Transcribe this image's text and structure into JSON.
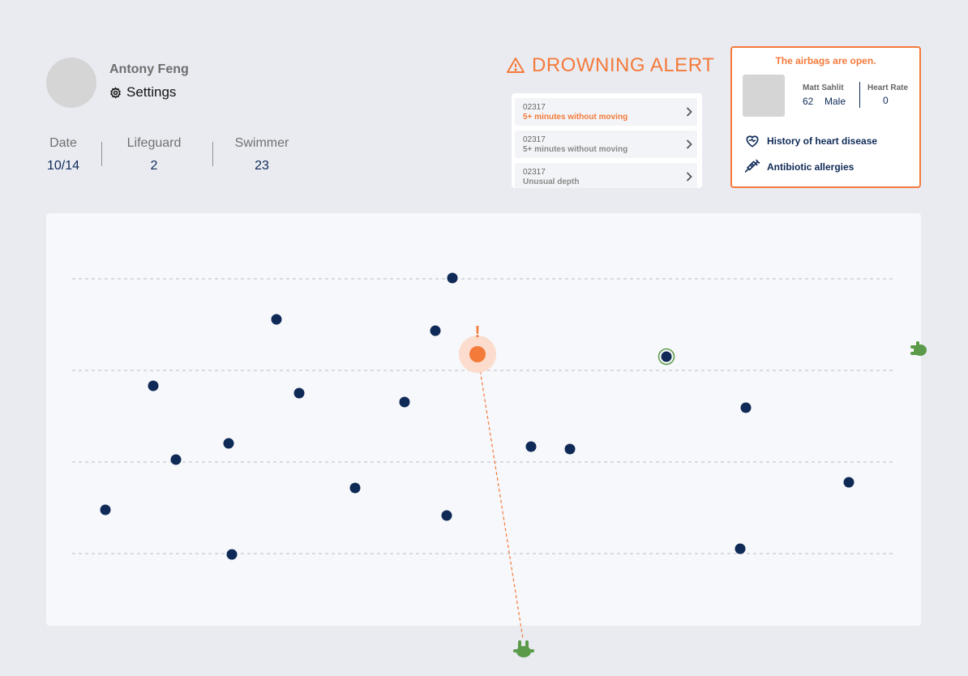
{
  "profile": {
    "name": "Antony Feng",
    "settings_label": "Settings"
  },
  "stats": [
    {
      "label": "Date",
      "value": "10/14"
    },
    {
      "label": "Lifeguard",
      "value": "2"
    },
    {
      "label": "Swimmer",
      "value": "23"
    }
  ],
  "alert": {
    "title": "DROWNING ALERT",
    "items": [
      {
        "id": "02317",
        "message": "5+ minutes without moving",
        "active": true
      },
      {
        "id": "02317",
        "message": "5+ minutes without moving",
        "active": false
      },
      {
        "id": "02317",
        "message": "Unusual depth",
        "active": false
      }
    ]
  },
  "card": {
    "header": "The airbags are open.",
    "patient_name": "Matt Sahlit",
    "age": "62",
    "sex": "Male",
    "heart_rate_label": "Heart Rate",
    "heart_rate_value": "0",
    "conditions": [
      {
        "icon": "heart-icon",
        "label": "History of heart disease"
      },
      {
        "icon": "syringe-icon",
        "label": "Antibiotic allergies"
      }
    ]
  },
  "pool": {
    "alert_marker": "!",
    "colors": {
      "swimmer": "#0f2a57",
      "alert": "#f47a3a",
      "lifeguard": "#5a9a48",
      "lane": "#b9bcc4"
    }
  }
}
